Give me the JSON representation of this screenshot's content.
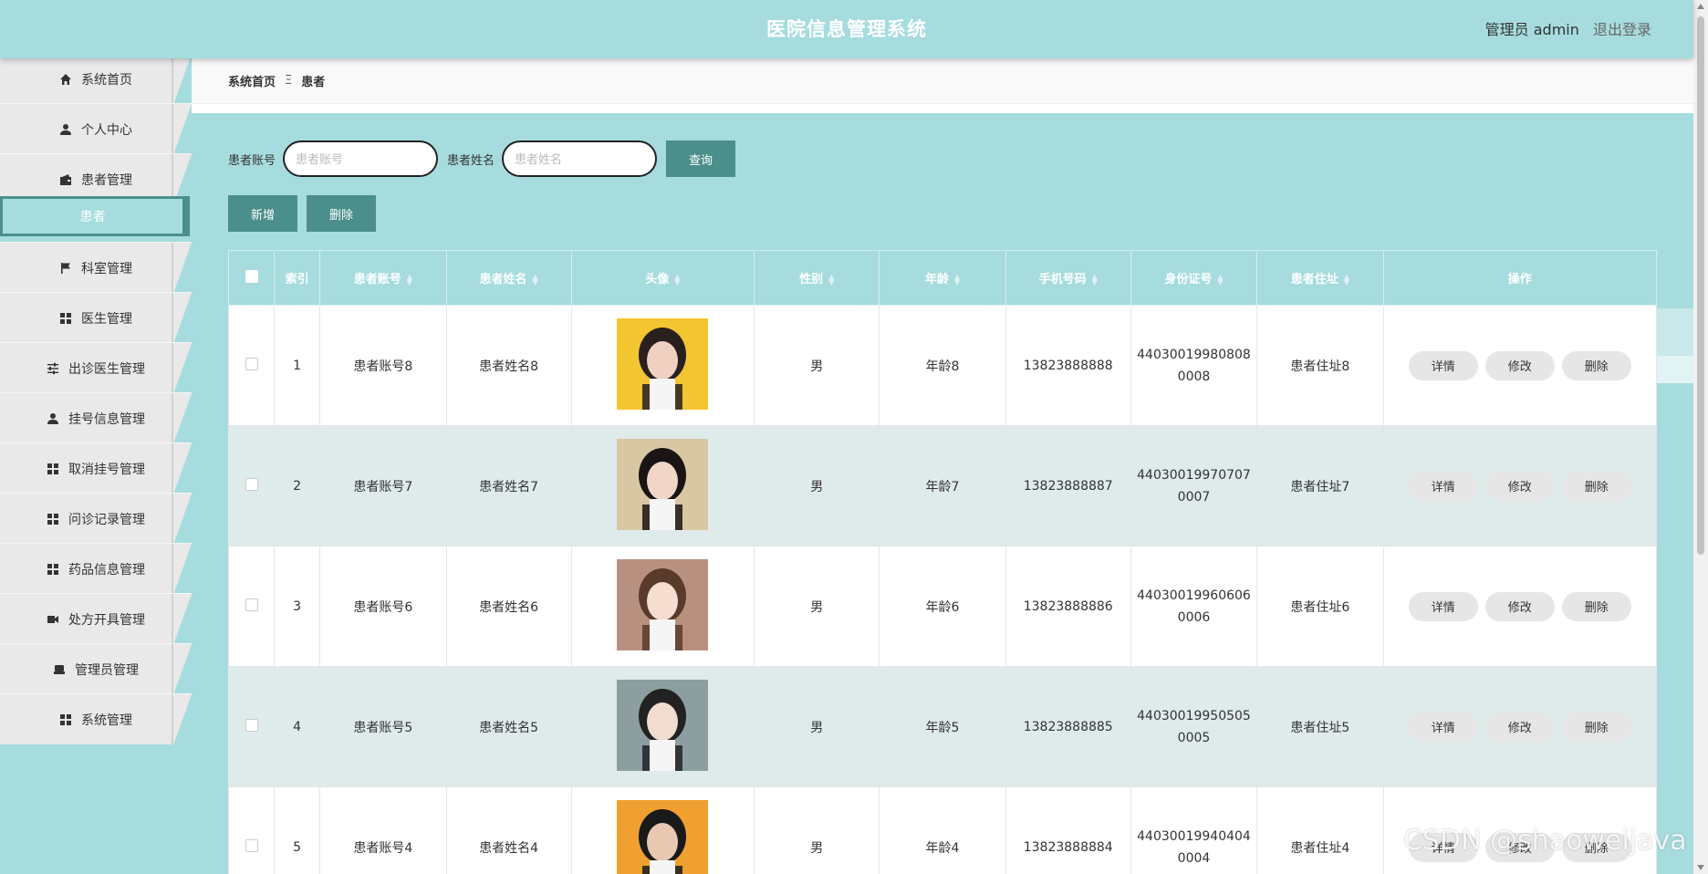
{
  "header": {
    "title": "医院信息管理系统",
    "user_text": "管理员 admin",
    "logout_label": "退出登录"
  },
  "sidebar": {
    "items": [
      {
        "label": "系统首页",
        "icon": "home-icon"
      },
      {
        "label": "个人中心",
        "icon": "user-icon"
      },
      {
        "label": "患者管理",
        "icon": "wallet-icon"
      },
      {
        "label": "患者",
        "icon": ""
      },
      {
        "label": "科室管理",
        "icon": "flag-icon"
      },
      {
        "label": "医生管理",
        "icon": "grid-icon"
      },
      {
        "label": "出诊医生管理",
        "icon": "sliders-icon"
      },
      {
        "label": "挂号信息管理",
        "icon": "user-icon"
      },
      {
        "label": "取消挂号管理",
        "icon": "grid-icon"
      },
      {
        "label": "问诊记录管理",
        "icon": "grid-icon"
      },
      {
        "label": "药品信息管理",
        "icon": "grid-icon"
      },
      {
        "label": "处方开具管理",
        "icon": "video-icon"
      },
      {
        "label": "管理员管理",
        "icon": "inbox-icon"
      },
      {
        "label": "系统管理",
        "icon": "grid-icon"
      }
    ]
  },
  "breadcrumb": {
    "home": "系统首页",
    "separator": "Ξ",
    "current": "患者"
  },
  "search": {
    "account_label": "患者账号",
    "account_placeholder": "患者账号",
    "name_label": "患者姓名",
    "name_placeholder": "患者姓名",
    "query_label": "查询"
  },
  "toolbar": {
    "add_label": "新增",
    "delete_label": "删除"
  },
  "table": {
    "headers": [
      "索引",
      "患者账号",
      "患者姓名",
      "头像",
      "性别",
      "年龄",
      "手机号码",
      "身份证号",
      "患者住址",
      "操作"
    ],
    "rows": [
      {
        "index": "1",
        "account": "患者账号8",
        "name": "患者姓名8",
        "gender": "男",
        "age": "年龄8",
        "phone": "13823888888",
        "id_number": "440300199808080008",
        "address": "患者住址8"
      },
      {
        "index": "2",
        "account": "患者账号7",
        "name": "患者姓名7",
        "gender": "男",
        "age": "年龄7",
        "phone": "13823888887",
        "id_number": "440300199707070007",
        "address": "患者住址7"
      },
      {
        "index": "3",
        "account": "患者账号6",
        "name": "患者姓名6",
        "gender": "男",
        "age": "年龄6",
        "phone": "13823888886",
        "id_number": "440300199606060006",
        "address": "患者住址6"
      },
      {
        "index": "4",
        "account": "患者账号5",
        "name": "患者姓名5",
        "gender": "男",
        "age": "年龄5",
        "phone": "13823888885",
        "id_number": "440300199505050005",
        "address": "患者住址5"
      },
      {
        "index": "5",
        "account": "患者账号4",
        "name": "患者姓名4",
        "gender": "男",
        "age": "年龄4",
        "phone": "13823888884",
        "id_number": "440300199404040004",
        "address": "患者住址4"
      }
    ],
    "row_actions": {
      "detail": "详情",
      "edit": "修改",
      "delete": "删除"
    }
  },
  "watermark": "CSDN @shaoweijava",
  "colors": {
    "header_bg": "#a6dcde",
    "accent": "#4b8f8c",
    "alt_row": "#dfeaea"
  }
}
